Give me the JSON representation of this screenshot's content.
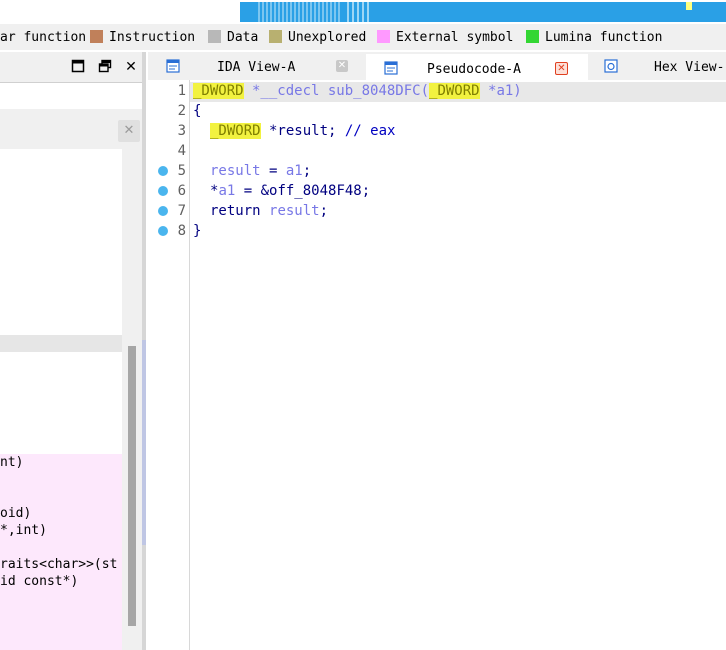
{
  "navband": {
    "segments": [
      {
        "color": "#ffffff"
      },
      {
        "color": "#2aa0e6"
      },
      {
        "color": "#7cc6f0"
      }
    ]
  },
  "legend": {
    "items": [
      {
        "label": "ar function",
        "color": "#00a0ff"
      },
      {
        "label": "Instruction",
        "color": "#c0805a"
      },
      {
        "label": "Data",
        "color": "#b8b8b8"
      },
      {
        "label": "Unexplored",
        "color": "#b8b070"
      },
      {
        "label": "External symbol",
        "color": "#ff99ff"
      },
      {
        "label": "Lumina function",
        "color": "#33d633"
      }
    ]
  },
  "left_pane": {
    "restore_icon": "⧉",
    "close_icon": "✕",
    "inner_close_icon": "✕",
    "list_fragments": [
      "nt)",
      "oid)",
      "*,int)",
      "raits<char>>(st",
      "id const*)"
    ]
  },
  "tabs": [
    {
      "label": "IDA View-A",
      "close": "✕"
    },
    {
      "label": "Pseudocode-A",
      "close": "✕"
    },
    {
      "label": "Hex View-"
    }
  ],
  "code": {
    "line_numbers": [
      "1",
      "2",
      "3",
      "4",
      "5",
      "6",
      "7",
      "8"
    ],
    "lines": {
      "l1": {
        "t1": "_DWORD",
        "t2": " *__cdecl sub_8048DFC(",
        "t3": "_DWORD",
        "t4": " *a1)"
      },
      "l2": {
        "t1": "{"
      },
      "l3": {
        "t1": "_DWORD",
        "t2": " *result; ",
        "t3": "// eax"
      },
      "l5": {
        "t1": "result",
        "t2": " = ",
        "t3": "a1",
        "t4": ";"
      },
      "l6": {
        "t1": "*",
        "t2": "a1",
        "t3": " = &off_8048F48;"
      },
      "l7": {
        "t1": "return ",
        "t2": "result",
        "t3": ";"
      },
      "l8": {
        "t1": "}"
      }
    }
  }
}
